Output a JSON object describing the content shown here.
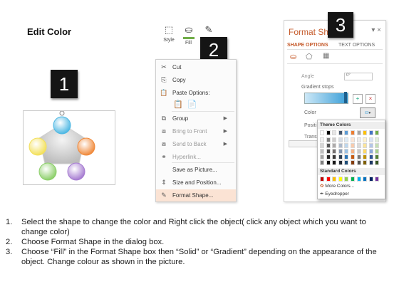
{
  "title": "Edit Color",
  "callouts": [
    "1",
    "2",
    "3"
  ],
  "ribbon": {
    "style_label": "Style",
    "fill_label": "Fill",
    "outline_label": "O",
    "fill_color": "#70ad47",
    "outline_color": "#e46c0a"
  },
  "context_menu": {
    "items": [
      {
        "label": "Cut",
        "icon": "scissors-icon",
        "enabled": true
      },
      {
        "label": "Copy",
        "icon": "copy-icon",
        "enabled": true
      },
      {
        "label": "Paste Options:",
        "icon": "paste-icon",
        "enabled": true
      },
      {
        "label": "Group",
        "icon": "group-icon",
        "enabled": true,
        "submenu": true
      },
      {
        "label": "Bring to Front",
        "icon": "bring-front-icon",
        "enabled": false,
        "submenu": true
      },
      {
        "label": "Send to Back",
        "icon": "send-back-icon",
        "enabled": false,
        "submenu": true
      },
      {
        "label": "Hyperlink...",
        "icon": "hyperlink-icon",
        "enabled": false
      },
      {
        "label": "Save as Picture...",
        "icon": "",
        "enabled": true
      },
      {
        "label": "Size and Position...",
        "icon": "size-position-icon",
        "enabled": true
      },
      {
        "label": "Format Shape...",
        "icon": "format-shape-icon",
        "enabled": true,
        "highlighted": true
      }
    ]
  },
  "format_pane": {
    "title": "Format Sh",
    "close": "▾ ×",
    "tabs": [
      "SHAPE OPTIONS",
      "TEXT OPTIONS"
    ],
    "angle_label": "Angle",
    "angle_value": "0°",
    "gradient_stops_label": "Gradient stops",
    "color_label": "Color",
    "position_label": "Positi",
    "transparency_label": "Trans",
    "accent_color": "#c55a2a",
    "gradient_colors": [
      "#cde8f7",
      "#3a9fd8"
    ]
  },
  "color_palette": {
    "theme_heading": "Theme Colors",
    "standard_heading": "Standard Colors",
    "more_colors": "More Colors...",
    "eyedropper": "Eyedropper",
    "theme_top": [
      "#ffffff",
      "#000000",
      "#e7e6e6",
      "#44546a",
      "#5b9bd5",
      "#ed7d31",
      "#a5a5a5",
      "#ffc000",
      "#4472c4",
      "#70ad47"
    ],
    "theme_tints": [
      [
        "#f2f2f2",
        "#7f7f7f",
        "#d0cece",
        "#d6dce4",
        "#deebf6",
        "#fbe5d5",
        "#ededed",
        "#fff2cc",
        "#d9e2f3",
        "#e2efd9"
      ],
      [
        "#d8d8d8",
        "#595959",
        "#aeabab",
        "#adb9ca",
        "#bdd7ee",
        "#f8cbad",
        "#dbdbdb",
        "#fee599",
        "#b4c6e7",
        "#c5e0b3"
      ],
      [
        "#bfbfbf",
        "#3f3f3f",
        "#757070",
        "#8496b0",
        "#9dc3e6",
        "#f4b183",
        "#c9c9c9",
        "#ffd965",
        "#8eaadb",
        "#a8d08d"
      ],
      [
        "#a5a5a5",
        "#262626",
        "#3a3838",
        "#323f4f",
        "#2e75b5",
        "#c55a11",
        "#7b7b7b",
        "#bf9000",
        "#2f5496",
        "#538135"
      ],
      [
        "#7f7f7f",
        "#0c0c0c",
        "#171616",
        "#222a35",
        "#1e4e79",
        "#833c0b",
        "#525252",
        "#7f6000",
        "#1f3864",
        "#375623"
      ]
    ],
    "standard": [
      "#c00000",
      "#ff0000",
      "#ffc000",
      "#ffff00",
      "#92d050",
      "#00b050",
      "#00b0f0",
      "#0070c0",
      "#002060",
      "#7030a0"
    ]
  },
  "diagram": {
    "center_color": "#d9d9d9",
    "circles": [
      {
        "name": "top",
        "color": "#4fb8e3"
      },
      {
        "name": "right",
        "color": "#f08a3c"
      },
      {
        "name": "bottom-right",
        "color": "#a67cd1"
      },
      {
        "name": "bottom-left",
        "color": "#8ccf6a"
      },
      {
        "name": "left",
        "color": "#f3e05a"
      }
    ]
  },
  "instructions": [
    {
      "num": "1.",
      "text": "Select the shape to change the color and Right click the object( click any object which you want to change color)"
    },
    {
      "num": "2.",
      "text": "Choose Format Shape in the dialog box."
    },
    {
      "num": "3.",
      "text": "Choose “Fill” in the Format Shape box then “Solid” or “Gradient” depending on the appearance of the object. Change colour as shown in the picture."
    }
  ]
}
